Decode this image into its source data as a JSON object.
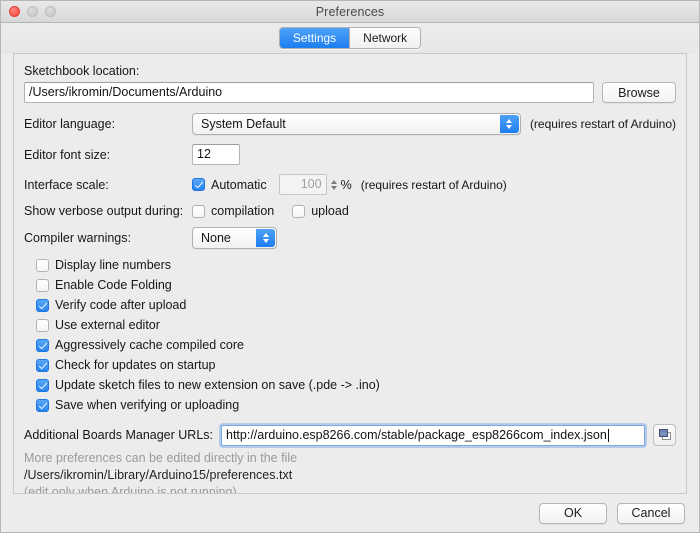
{
  "window": {
    "title": "Preferences",
    "traffic_lights": [
      "close-button",
      "minimize-button",
      "maximize-button"
    ]
  },
  "tabs": [
    {
      "label": "Settings",
      "active": true
    },
    {
      "label": "Network",
      "active": false
    }
  ],
  "form": {
    "sketchbook": {
      "label": "Sketchbook location:",
      "value": "/Users/ikromin/Documents/Arduino",
      "browse_label": "Browse"
    },
    "editor_language": {
      "label": "Editor language:",
      "value": "System Default",
      "note": "(requires restart of Arduino)"
    },
    "editor_font_size": {
      "label": "Editor font size:",
      "value": "12"
    },
    "interface_scale": {
      "label": "Interface scale:",
      "automatic_label": "Automatic",
      "automatic_checked": true,
      "value": "100",
      "percent": "%",
      "note": "(requires restart of Arduino)"
    },
    "verbose_output": {
      "label": "Show verbose output during:",
      "options": [
        {
          "label": "compilation",
          "checked": false
        },
        {
          "label": "upload",
          "checked": false
        }
      ]
    },
    "compiler_warnings": {
      "label": "Compiler warnings:",
      "value": "None"
    },
    "checkboxes": [
      {
        "label": "Display line numbers",
        "checked": false
      },
      {
        "label": "Enable Code Folding",
        "checked": false
      },
      {
        "label": "Verify code after upload",
        "checked": true
      },
      {
        "label": "Use external editor",
        "checked": false
      },
      {
        "label": "Aggressively cache compiled core",
        "checked": true
      },
      {
        "label": "Check for updates on startup",
        "checked": true
      },
      {
        "label": "Update sketch files to new extension on save (.pde -> .ino)",
        "checked": true
      },
      {
        "label": "Save when verifying or uploading",
        "checked": true
      }
    ],
    "boards_manager": {
      "label": "Additional Boards Manager URLs:",
      "value": "http://arduino.esp8266.com/stable/package_esp8266com_index.json",
      "icon": "duplicate-windows-icon"
    },
    "help": {
      "line1": "More preferences can be edited directly in the file",
      "path": "/Users/ikromin/Library/Arduino15/preferences.txt",
      "line3": "(edit only when Arduino is not running)"
    }
  },
  "footer": {
    "ok_label": "OK",
    "cancel_label": "Cancel"
  },
  "colors": {
    "accent_blue": "#1d7ef0",
    "window_bg": "#ececec",
    "muted_text": "#9a9a9a"
  }
}
